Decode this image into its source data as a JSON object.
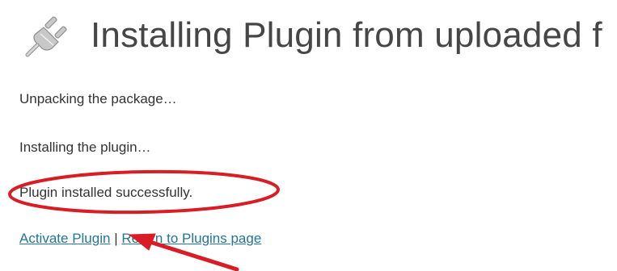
{
  "header": {
    "title": "Installing Plugin from uploaded f",
    "icon": "plugin-icon"
  },
  "messages": [
    "Unpacking the package…",
    "Installing the plugin…",
    "Plugin installed successfully."
  ],
  "actions": {
    "activate_label": "Activate Plugin",
    "separator": "|",
    "return_label": "Return to Plugins page"
  },
  "annotations": {
    "highlight_color": "#d81e24",
    "shapes": [
      "ellipse-highlight",
      "arrow-pointer"
    ]
  },
  "colors": {
    "link": "#21759b",
    "text": "#333333",
    "heading": "#464646"
  }
}
